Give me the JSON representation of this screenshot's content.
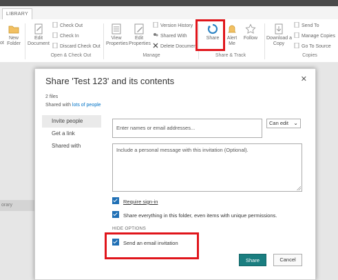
{
  "ribbon": {
    "tab_library": "LIBRARY",
    "new_folder": "New\nFolder",
    "edit_document": "Edit\nDocument",
    "check_out": "Check Out",
    "check_in": "Check In",
    "discard_check_out": "Discard Check Out",
    "group_open_checkout": "Open & Check Out",
    "view_properties": "View\nProperties",
    "edit_properties": "Edit\nProperties",
    "version_history": "Version History",
    "shared_with": "Shared With",
    "delete_document": "Delete Document",
    "group_manage": "Manage",
    "share": "Share",
    "alert_me": "Alert\nMe",
    "follow": "Follow",
    "group_share_track": "Share & Track",
    "download_copy": "Download a\nCopy",
    "send_to": "Send To",
    "manage_copies": "Manage Copies",
    "go_to_source": "Go To Source",
    "group_copies": "Copies",
    "left_cut_label": "ot"
  },
  "background": {
    "library_label": "orary"
  },
  "dialog": {
    "title": "Share 'Test 123' and its contents",
    "close": "✕",
    "files_count": "2 files",
    "shared_with_prefix": "Shared with ",
    "shared_with_link": "lots of people",
    "nav": [
      "Invite people",
      "Get a link",
      "Shared with"
    ],
    "invite_placeholder": "Enter names or email addresses...",
    "permission": "Can edit",
    "message_placeholder": "Include a personal message with this invitation (Optional).",
    "require_signin": "Require sign-in",
    "share_everything": "Share everything in this folder, even items with unique permissions.",
    "hide_options": "HIDE OPTIONS",
    "send_email": "Send an email invitation",
    "share_button": "Share",
    "cancel_button": "Cancel"
  },
  "colors": {
    "accent_teal": "#1a7e80",
    "checkbox_blue": "#1f6fb5",
    "link_blue": "#0072c6",
    "highlight_red": "#e0151b"
  }
}
